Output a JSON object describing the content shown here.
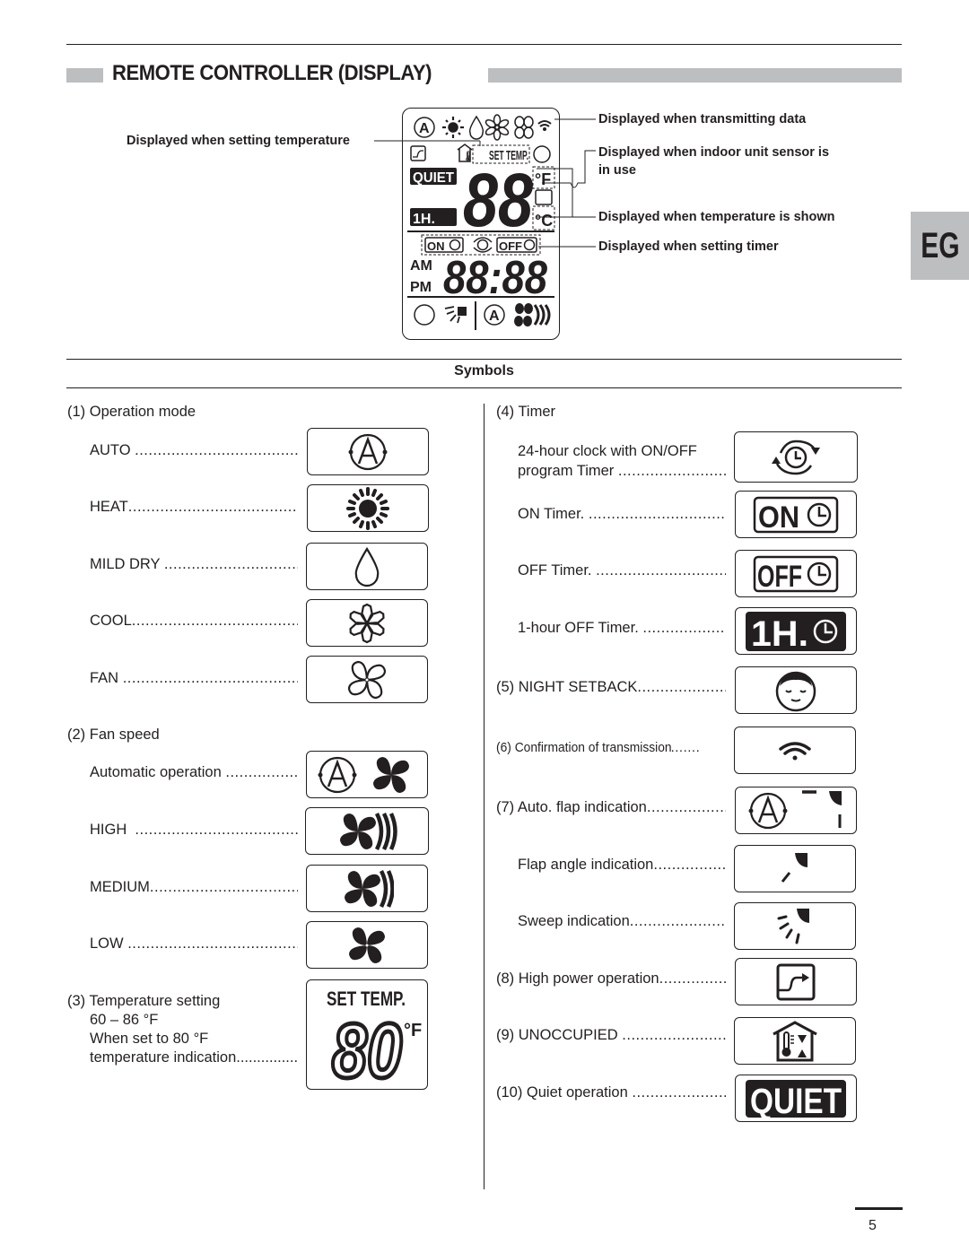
{
  "page": {
    "section_title": "REMOTE CONTROLLER (DISPLAY)",
    "language_tab": "EG",
    "page_number": "5"
  },
  "display_diagram": {
    "callouts": {
      "setting_temperature": "Displayed when setting temperature",
      "transmitting_data": "Displayed when transmitting data",
      "indoor_sensor_line1": "Displayed when indoor unit sensor is",
      "indoor_sensor_line2": "in use",
      "temperature_shown": "Displayed when temperature is shown",
      "setting_timer": "Displayed when setting timer"
    },
    "lcd": {
      "set_temp": "SET TEMP.",
      "quiet": "QUIET",
      "one_hour": "1H.",
      "temp_digits": "88",
      "deg_f": "°F",
      "deg_c": "°C",
      "on": "ON",
      "off": "OFF",
      "am": "AM",
      "pm": "PM",
      "clock_digits": "88:88"
    }
  },
  "symbols": {
    "heading": "Symbols",
    "left_column": [
      {
        "type": "section",
        "text": "(1) Operation mode"
      },
      {
        "type": "item",
        "label": "AUTO",
        "icon": "auto-mode-icon"
      },
      {
        "type": "item",
        "label": "HEAT",
        "icon": "heat-sun-icon"
      },
      {
        "type": "item",
        "label": "MILD DRY",
        "icon": "dry-drop-icon"
      },
      {
        "type": "item",
        "label": "COOL",
        "icon": "cool-snowflake-icon"
      },
      {
        "type": "item",
        "label": "FAN",
        "icon": "fan-outline-icon"
      },
      {
        "type": "section",
        "text": "(2) Fan speed"
      },
      {
        "type": "item",
        "label": "Automatic operation",
        "icon": "fan-auto-icon"
      },
      {
        "type": "item",
        "label": "HIGH",
        "icon": "fan-high-icon"
      },
      {
        "type": "item",
        "label": "MEDIUM",
        "icon": "fan-medium-icon"
      },
      {
        "type": "item",
        "label": "LOW",
        "icon": "fan-low-icon"
      },
      {
        "type": "section",
        "text": "(3) Temperature setting"
      }
    ],
    "temperature_setting": {
      "title": "(3) Temperature setting",
      "range": "60 – 86 °F",
      "line3": "When set to 80 °F",
      "line4": "temperature indication",
      "box_set_temp": "SET TEMP.",
      "box_value": "80",
      "box_unit": "°F"
    },
    "labels": {
      "s1": "(1) Operation mode",
      "auto": "AUTO",
      "heat": "HEAT",
      "mild_dry": "MILD DRY",
      "cool": "COOL",
      "fan": "FAN",
      "s2": "(2) Fan speed",
      "fan_auto": "Automatic operation",
      "high": "HIGH",
      "medium": "MEDIUM",
      "low": "LOW",
      "s4": "(4) Timer",
      "clock_line1": "24-hour clock with ON/OFF",
      "clock_line2": "program Timer",
      "on_timer": "ON Timer.",
      "off_timer": "OFF Timer.",
      "one_hour_off": "1-hour OFF Timer.",
      "night_setback": "(5) NIGHT SETBACK",
      "transmission": "(6) Confirmation of transmission",
      "auto_flap": "(7) Auto. flap indication",
      "flap_angle": "Flap angle indication",
      "sweep": "Sweep indication",
      "high_power": "(8) High power operation",
      "unoccupied": "(9) UNOCCUPIED",
      "quiet": "(10) Quiet operation"
    },
    "icon_text": {
      "on": "ON",
      "off": "OFF",
      "one_hour": "1H.",
      "quiet": "QUIET"
    }
  },
  "colors": {
    "ink": "#231f20",
    "tab_gray": "#bcbec0"
  }
}
